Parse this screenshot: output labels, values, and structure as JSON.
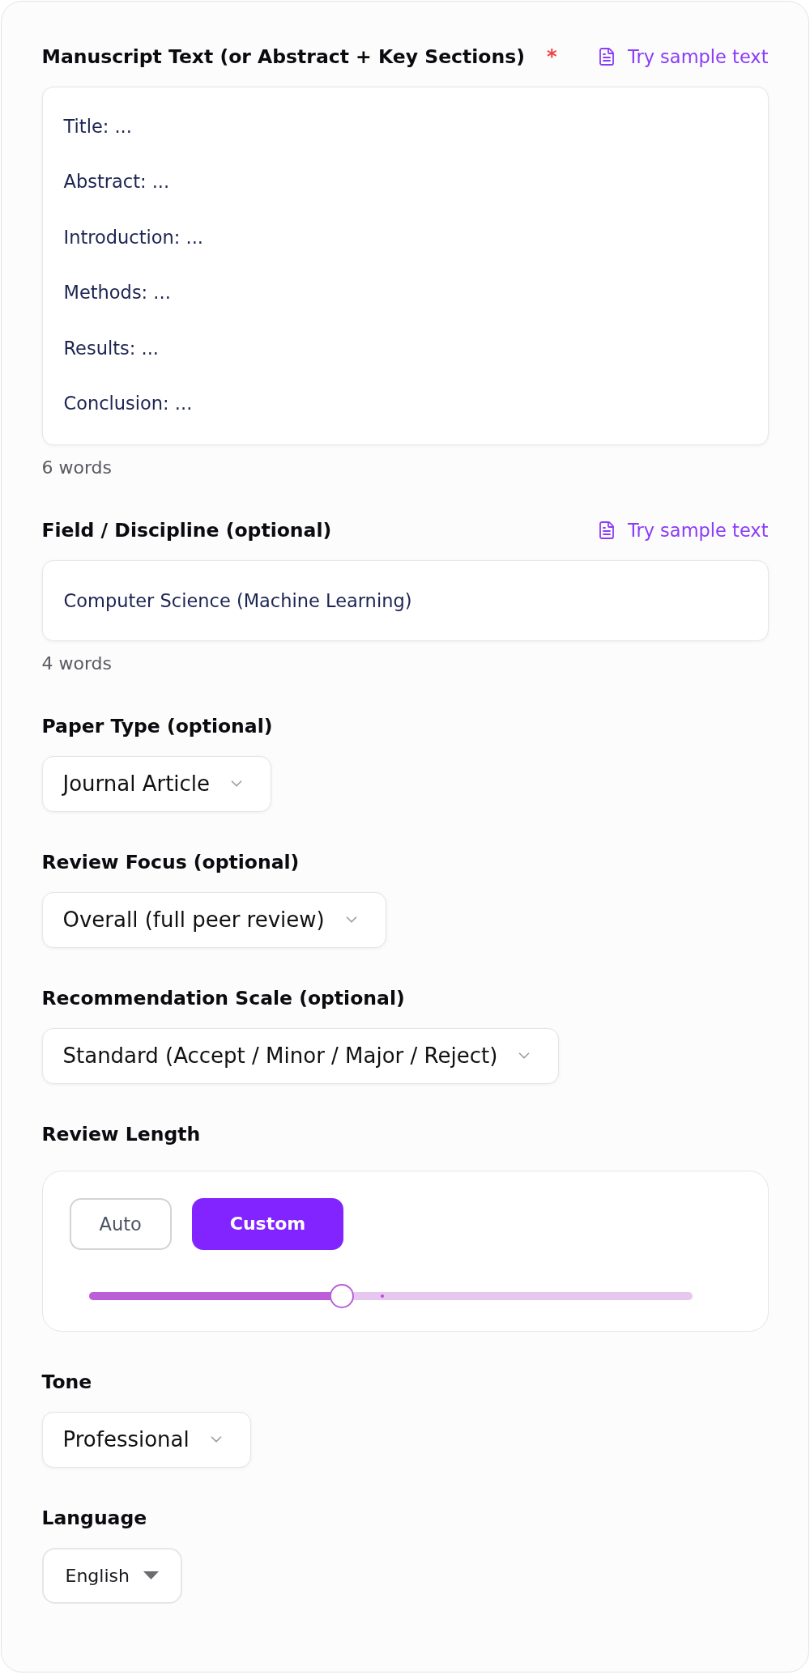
{
  "fields": [
    {
      "kind": "textarea",
      "label": "Manuscript Text (or Abstract + Key Sections)",
      "required_mark": "*",
      "sample_link": "Try sample text",
      "value": "Title: ...\n\nAbstract: ...\n\nIntroduction: ...\n\nMethods: ...\n\nResults: ...\n\nConclusion: ...",
      "word_count": "6 words"
    },
    {
      "kind": "input",
      "label": "Field / Discipline (optional)",
      "sample_link": "Try sample text",
      "value": "Computer Science (Machine Learning)",
      "word_count": "4 words"
    },
    {
      "kind": "select",
      "label": "Paper Type (optional)",
      "value": "Journal Article"
    },
    {
      "kind": "select",
      "label": "Review Focus (optional)",
      "value": "Overall (full peer review)"
    },
    {
      "kind": "select",
      "label": "Recommendation Scale (optional)",
      "value": "Standard (Accept / Minor / Major / Reject)"
    },
    {
      "kind": "length",
      "label": "Review Length",
      "options": [
        {
          "label": "Auto",
          "selected": false
        },
        {
          "label": "Custom",
          "selected": true
        }
      ],
      "slider": {
        "level": 0.42
      }
    },
    {
      "kind": "select",
      "label": "Tone",
      "value": "Professional"
    },
    {
      "kind": "native",
      "label": "Language",
      "value": "English"
    }
  ]
}
